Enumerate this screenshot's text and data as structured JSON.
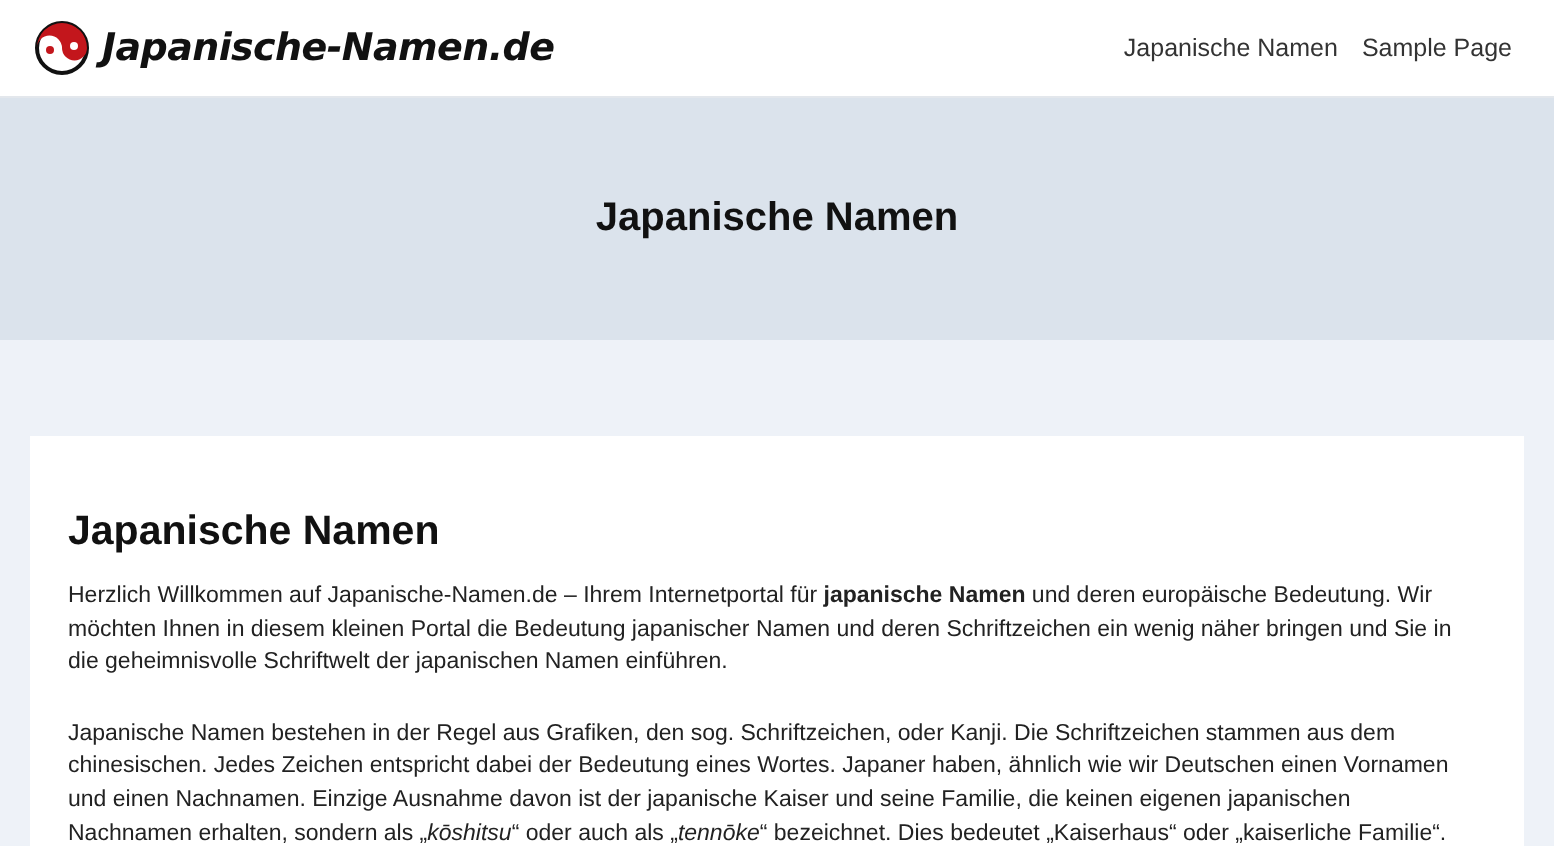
{
  "header": {
    "logo_text": "Japanische-Namen.de",
    "nav": [
      {
        "label": "Japanische Namen"
      },
      {
        "label": "Sample Page"
      }
    ]
  },
  "hero": {
    "title": "Japanische Namen"
  },
  "article": {
    "heading": "Japanische Namen",
    "paragraphs": [
      "Herzlich Willkommen auf Japanische-Namen.de – Ihrem Internetportal für **japanische Namen** und deren europäische Bedeutung. Wir möchten Ihnen in diesem kleinen Portal die Bedeutung japanischer Namen und deren Schriftzeichen ein wenig näher bringen und Sie in die geheimnisvolle Schriftwelt der japanischen Namen einführen.",
      "Japanische Namen bestehen in der Regel aus Grafiken, den sog. Schriftzeichen, oder Kanji. Die Schriftzeichen stammen aus dem chinesischen. Jedes Zeichen entspricht dabei der Bedeutung eines Wortes.  Japaner haben, ähnlich wie wir Deutschen einen Vornamen und einen Nachnamen. Einzige Ausnahme davon ist der japanische Kaiser und seine Familie, die keinen eigenen japanischen Nachnamen erhalten, sondern als „*kōshitsu*“ oder auch als „*tennōke*“ bezeichnet. Dies bedeutet „Kaiserhaus“ oder „kaiserliche Familie“."
    ]
  }
}
